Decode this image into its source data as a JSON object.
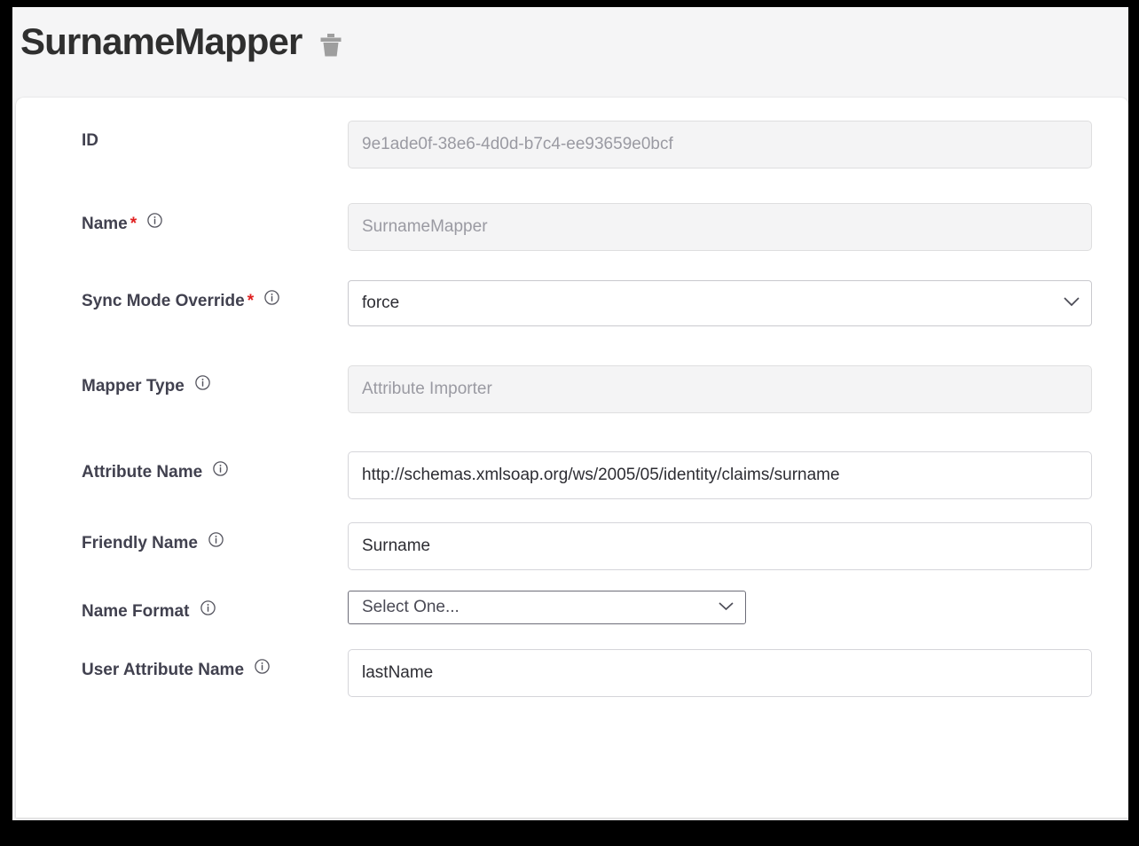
{
  "header": {
    "title": "SurnameMapper",
    "delete_icon": "trash-icon"
  },
  "form": {
    "rows": [
      {
        "label": "ID",
        "required": false,
        "has_info": false,
        "control": "text",
        "value": "9e1ade0f-38e6-4d0d-b7c4-ee93659e0bcf",
        "disabled": true
      },
      {
        "label": "Name",
        "required": true,
        "has_info": true,
        "control": "text",
        "value": "SurnameMapper",
        "disabled": true
      },
      {
        "label": "Sync Mode Override",
        "required": true,
        "has_info": true,
        "control": "select",
        "value": "force",
        "disabled": false
      },
      {
        "label": "Mapper Type",
        "required": false,
        "has_info": true,
        "control": "text",
        "value": "Attribute Importer",
        "disabled": true
      },
      {
        "label": "Attribute Name",
        "required": false,
        "has_info": true,
        "control": "text",
        "value": "http://schemas.xmlsoap.org/ws/2005/05/identity/claims/surname",
        "disabled": false
      },
      {
        "label": "Friendly Name",
        "required": false,
        "has_info": true,
        "control": "text",
        "value": "Surname",
        "disabled": false
      },
      {
        "label": "Name Format",
        "required": false,
        "has_info": true,
        "control": "select-native",
        "value": "Select One...",
        "disabled": false
      },
      {
        "label": "User Attribute Name",
        "required": false,
        "has_info": true,
        "control": "text",
        "value": "lastName",
        "disabled": false
      }
    ]
  },
  "colors": {
    "required_star": "#e02020",
    "label_text": "#41414f",
    "title_text": "#2f2f2f",
    "disabled_bg": "#f4f4f5",
    "disabled_text": "#9a9aa2",
    "page_bg": "#f5f5f6",
    "card_bg": "#ffffff",
    "trash_icon": "#9e9e9e"
  },
  "icons": {
    "info": "info-circle-icon",
    "chevron": "chevron-down-icon"
  }
}
